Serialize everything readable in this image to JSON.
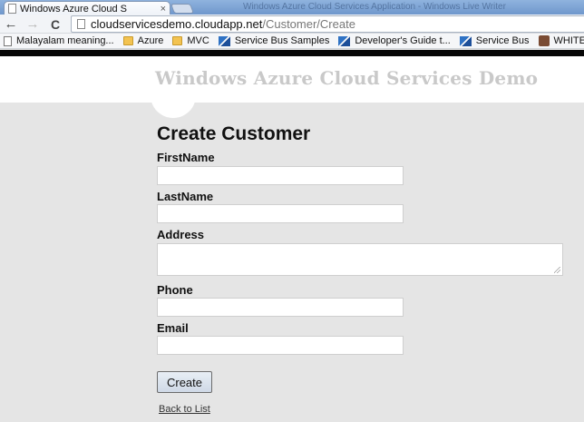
{
  "browser": {
    "tab_title": "Windows Azure Cloud S",
    "tab_close": "×",
    "window_title_faded": "Windows Azure Cloud Services Application - Windows Live Writer",
    "url_host": "cloudservicesdemo.cloudapp.net",
    "url_path": "/Customer/Create",
    "back_glyph": "←",
    "forward_glyph": "→",
    "reload_glyph": "C",
    "bookmarks": [
      {
        "icon": "page-icon",
        "label": "Malayalam meaning..."
      },
      {
        "icon": "folder-icon",
        "label": "Azure"
      },
      {
        "icon": "folder-icon",
        "label": "MVC"
      },
      {
        "icon": "azure-logo-icon",
        "label": "Service Bus Samples"
      },
      {
        "icon": "azure-logo-icon",
        "label": "Developer's Guide t..."
      },
      {
        "icon": "azure-logo-icon",
        "label": "Service Bus"
      },
      {
        "icon": "photo-icon",
        "label": "WHITEPAP"
      }
    ]
  },
  "site": {
    "title": "Windows Azure Cloud Services Demo"
  },
  "form": {
    "heading": "Create Customer",
    "fields": [
      {
        "label": "FirstName",
        "value": ""
      },
      {
        "label": "LastName",
        "value": ""
      },
      {
        "label": "Address",
        "value": ""
      },
      {
        "label": "Phone",
        "value": ""
      },
      {
        "label": "Email",
        "value": ""
      }
    ],
    "submit_label": "Create",
    "back_link": "Back to List"
  }
}
